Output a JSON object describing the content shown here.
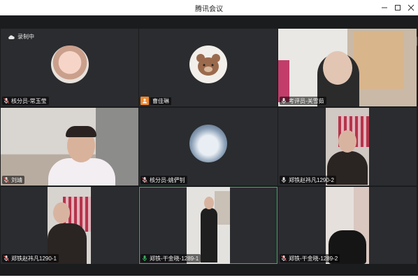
{
  "window": {
    "title": "腾讯会议",
    "controls": [
      "minimize-icon",
      "maximize-icon",
      "close-icon"
    ]
  },
  "recording": {
    "label": "录制中",
    "icon": "cloud-icon"
  },
  "participants": [
    {
      "name": "核分员-常玉莹",
      "mic": "muted",
      "content": "avatar"
    },
    {
      "name": "曹佳琳",
      "mic": "none",
      "icon": "user-icon",
      "content": "avatar"
    },
    {
      "name": "考评员-关雪茹",
      "mic": "on",
      "content": "video"
    },
    {
      "name": "刘靖",
      "mic": "muted",
      "content": "video"
    },
    {
      "name": "核分员-姚俨钊",
      "mic": "muted",
      "content": "avatar"
    },
    {
      "name": "郑铁赵祎凡1290-2",
      "mic": "on",
      "content": "video"
    },
    {
      "name": "郑铁赵祎凡1290-1",
      "mic": "muted",
      "content": "video"
    },
    {
      "name": "郑铁-干金晓-1289-1",
      "mic": "on",
      "content": "video",
      "active": true
    },
    {
      "name": "郑铁-干金晓-1289-2",
      "mic": "muted",
      "content": "video"
    }
  ],
  "colors": {
    "background": "#1b1c1e",
    "tile": "#2a2c2f",
    "active_border": "#3fae63",
    "user_badge": "#f0892c"
  }
}
